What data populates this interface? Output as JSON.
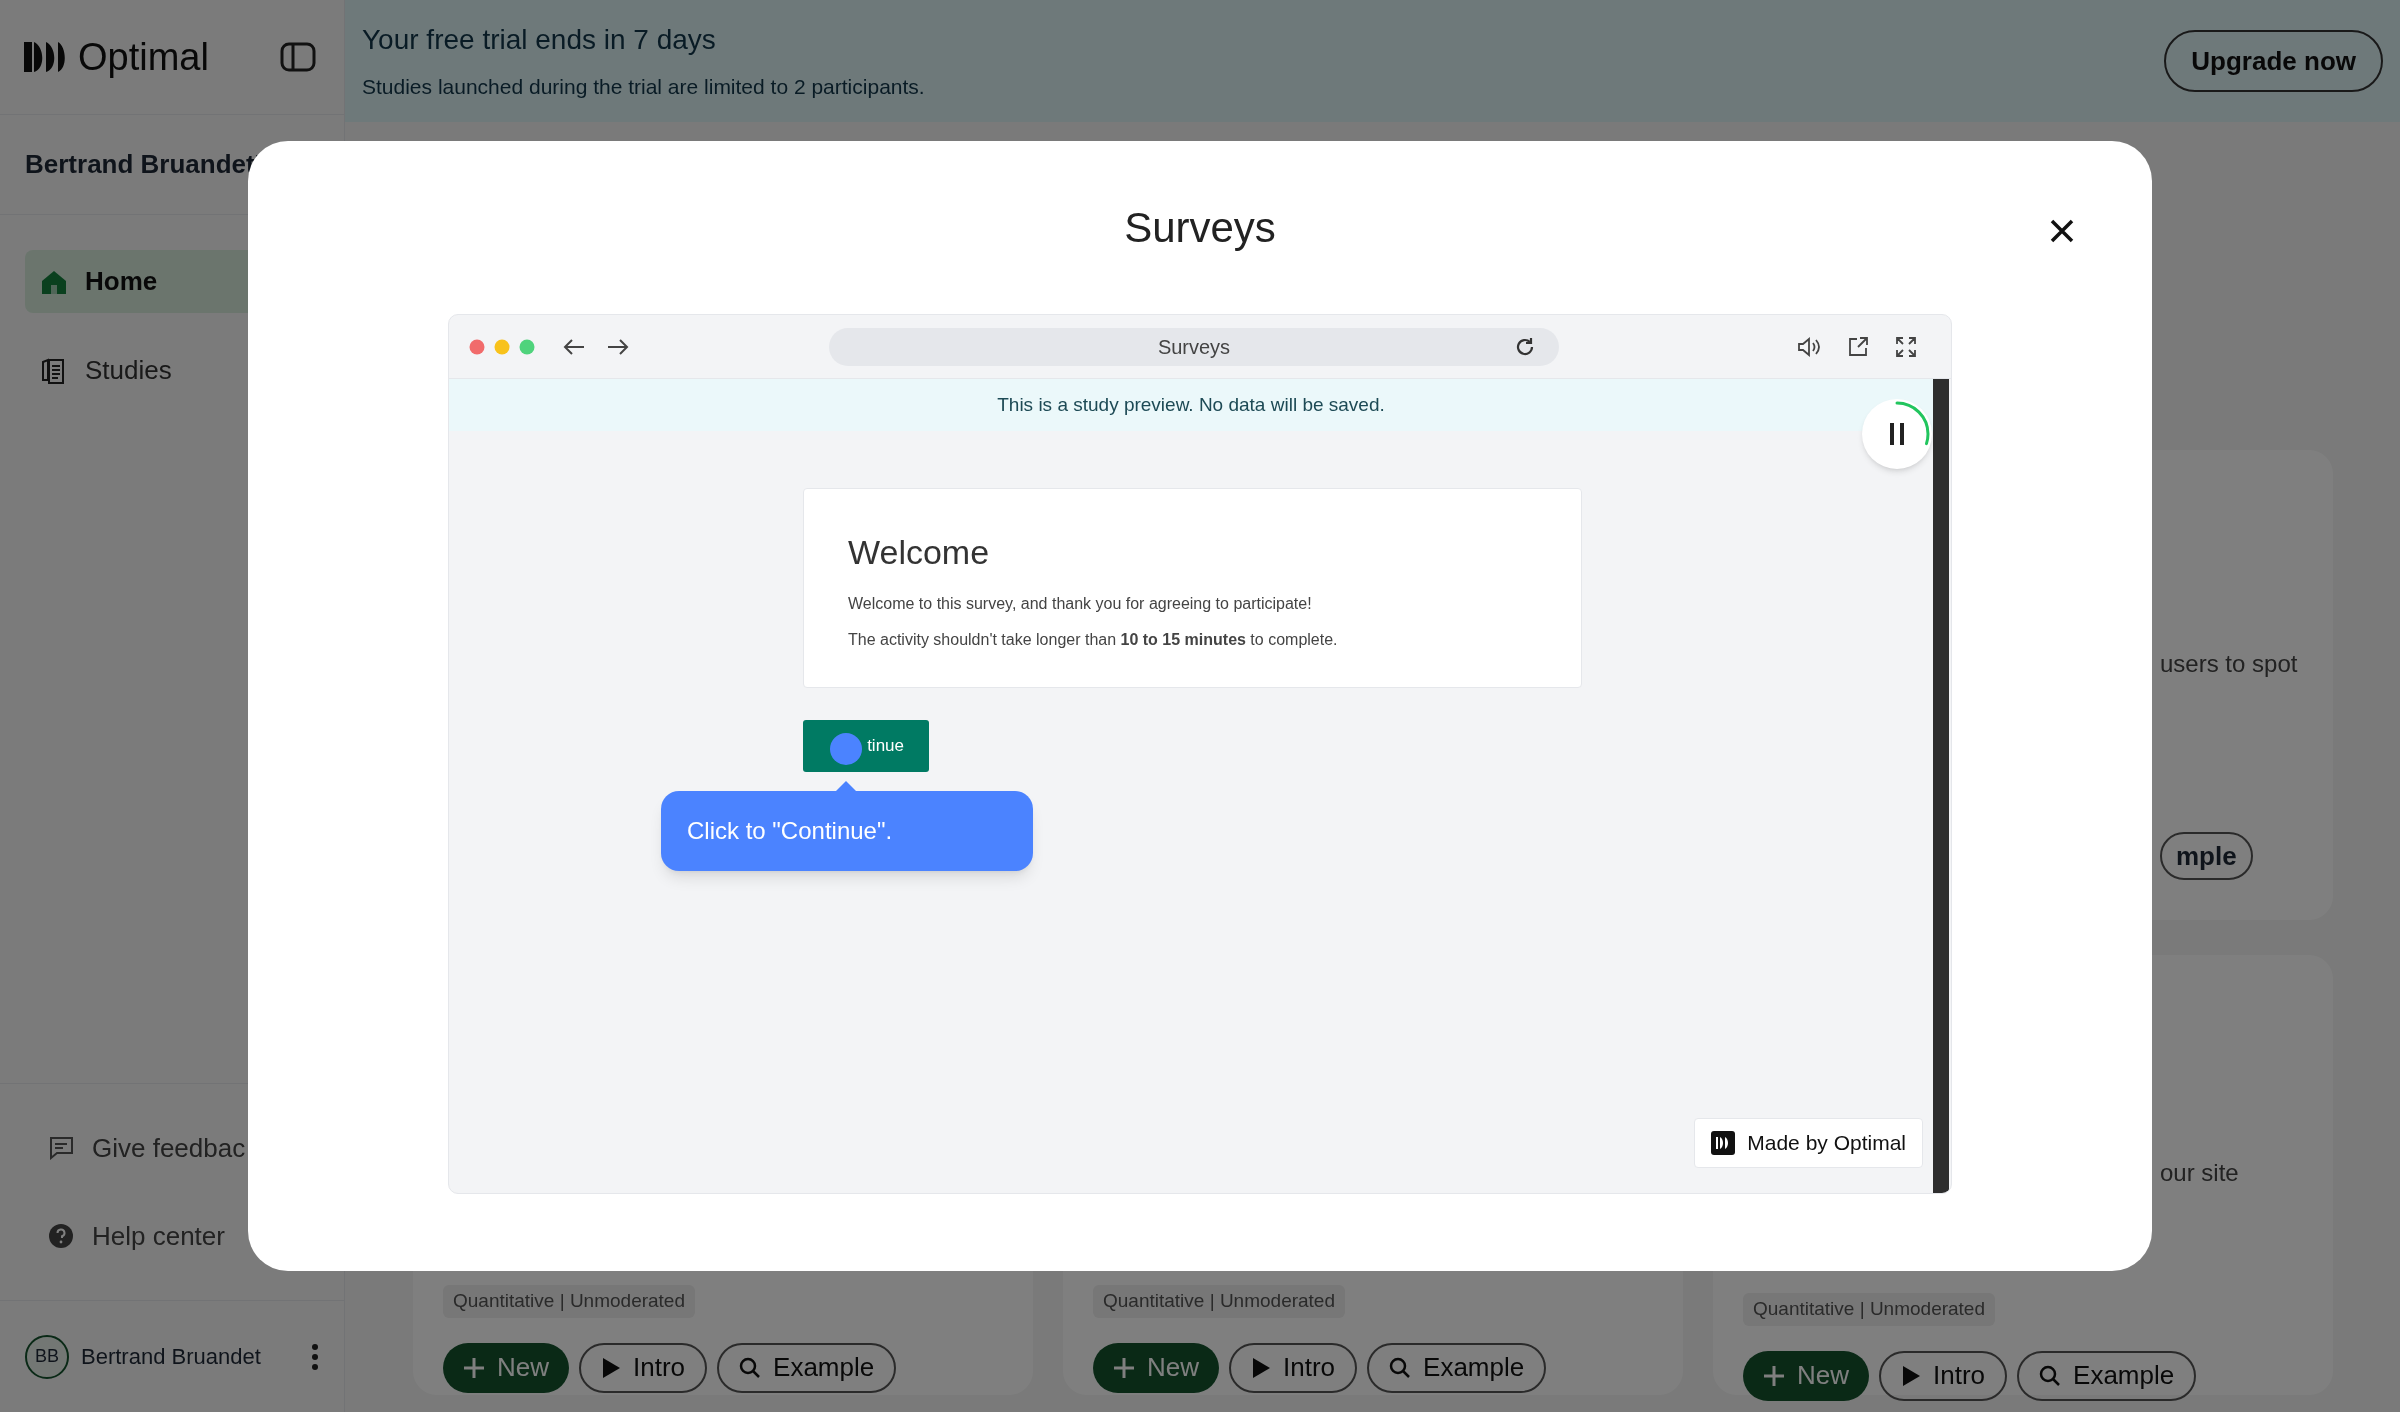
{
  "sidebar": {
    "brand": "Optimal",
    "workspace": "Bertrand Bruandet'",
    "nav": [
      {
        "label": "Home",
        "kind": "home",
        "selected": true
      },
      {
        "label": "Studies",
        "kind": "studies",
        "selected": false
      }
    ],
    "footer_links": [
      {
        "label": "Give feedbac",
        "kind": "feedback"
      },
      {
        "label": "Help center",
        "kind": "help"
      }
    ],
    "user": {
      "initials": "BB",
      "name": "Bertrand Bruandet"
    }
  },
  "trial_banner": {
    "title": "Your free trial ends in 7 days",
    "text": "Studies launched during the trial are limited to 2 participants.",
    "button": "Upgrade now"
  },
  "top_card": {
    "description": "users to spot",
    "button": "mple"
  },
  "study_cards": [
    {
      "tag": "Quantitative | Unmoderated",
      "buttons": [
        {
          "label": "New",
          "kind": "add"
        },
        {
          "label": "Intro",
          "kind": "play"
        },
        {
          "label": "Example",
          "kind": "search"
        }
      ]
    },
    {
      "tag": "Quantitative | Unmoderated",
      "buttons": [
        {
          "label": "New",
          "kind": "add"
        },
        {
          "label": "Intro",
          "kind": "play"
        },
        {
          "label": "Example",
          "kind": "search"
        }
      ]
    },
    {
      "description": "our site",
      "tag": "Quantitative | Unmoderated",
      "buttons": [
        {
          "label": "New",
          "kind": "add"
        },
        {
          "label": "Intro",
          "kind": "play"
        },
        {
          "label": "Example",
          "kind": "search"
        }
      ]
    }
  ],
  "modal": {
    "title": "Surveys",
    "preview": {
      "address": "Surveys",
      "notice": "This is a study preview. No data will be saved.",
      "timer": {
        "level": 0.3
      },
      "welcome": {
        "heading": "Welcome",
        "lines": [
          "Welcome to this survey, and thank you for agreeing to participate!",
          "The activity shouldn't take longer than **10 to 15 minutes** to complete."
        ]
      },
      "button": "tinue",
      "tooltip": "Click to \"Continue\".",
      "badge": "Made by Optimal"
    }
  }
}
